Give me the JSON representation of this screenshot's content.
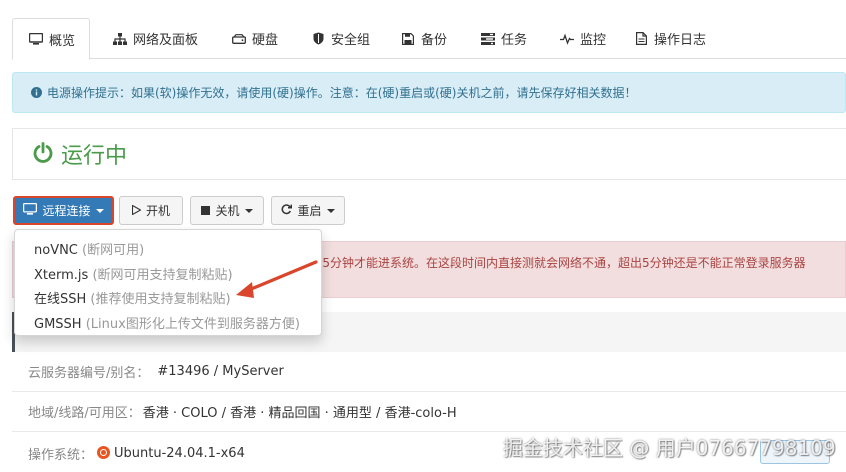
{
  "tabs": [
    {
      "label": "概览",
      "icon": "monitor-icon",
      "active": true
    },
    {
      "label": "网络及面板",
      "icon": "sitemap-icon"
    },
    {
      "label": "硬盘",
      "icon": "hdd-icon"
    },
    {
      "label": "安全组",
      "icon": "shield-icon"
    },
    {
      "label": "备份",
      "icon": "save-icon"
    },
    {
      "label": "任务",
      "icon": "tasks-icon"
    },
    {
      "label": "监控",
      "icon": "pulse-icon"
    },
    {
      "label": "操作日志",
      "icon": "file-icon"
    }
  ],
  "alert": {
    "text": "电源操作提示：如果(软)操作无效，请使用(硬)操作。注意：在(硬)重启或(硬)关机之前，请先保存好相关数据！",
    "icon": "info-circle-icon"
  },
  "status": {
    "text": "运行中",
    "icon": "power-icon",
    "color": "#4a9b4a"
  },
  "actions": {
    "remote_label": "远程连接",
    "start_label": "开机",
    "shutdown_label": "关机",
    "restart_label": "重启"
  },
  "dropdown": {
    "items": [
      {
        "name": "noVNC",
        "note": "(断网可用)"
      },
      {
        "name": "Xterm.js",
        "note": "(断网可用支持复制粘贴)"
      },
      {
        "name": "在线SSH",
        "note": "(推荐使用支持复制粘贴)"
      },
      {
        "name": "GMSSH",
        "note": "(Linux图形化上传文件到服务器方便)"
      }
    ]
  },
  "danger_alert": {
    "line1": "-5分钟才能进系统。在这段时间内直接测就会网络不通，超出5分钟还是不能正常登录服务器",
    "line2": ""
  },
  "info": {
    "server_id_label": "云服务器编号/别名：",
    "server_id_value": "#13496 / MyServer",
    "region_label": "地域/线路/可用区：",
    "region_value": "香港 · COLO / 香港 · 精品回国 · 通用型 / 香港-colo-H",
    "os_label": "操作系统：",
    "os_value": "Ubuntu-24.04.1-x64"
  },
  "watermark": "掘金技术社区 @ 用户07667798109",
  "colors": {
    "primary": "#337ab7",
    "highlight_border": "#d9462b",
    "arrow": "#d9462b",
    "alert_bg": "#d9edf7",
    "danger_bg": "#f2dede"
  }
}
